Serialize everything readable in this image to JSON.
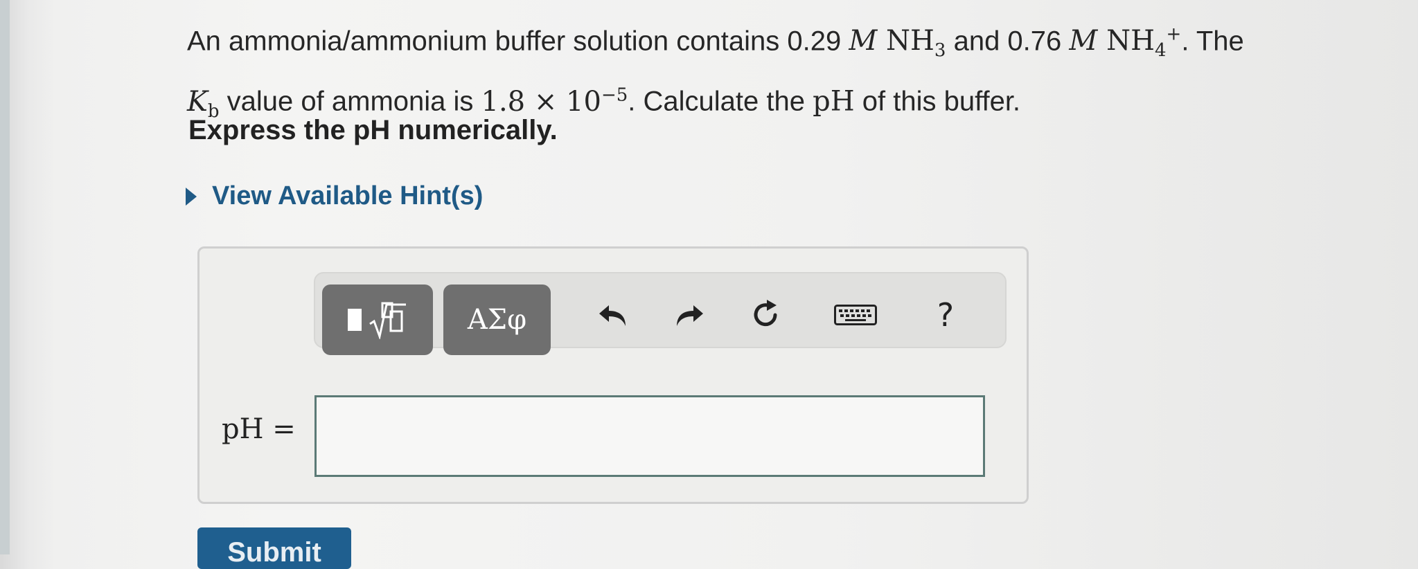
{
  "question": {
    "line1_text_a": "An ammonia/ammonium buffer solution contains 0.29 ",
    "line1_unit_a": "M",
    "line1_species_a": "NH",
    "line1_species_a_sub": "3",
    "line1_text_b": " and 0.76 ",
    "line1_unit_b": "M",
    "line1_species_b": "NH",
    "line1_species_b_sub": "4",
    "line1_species_b_sup": "+",
    "line1_text_c": ". The",
    "kb_symbol": "K",
    "kb_sub": "b",
    "line2_text_a": " value of ammonia is ",
    "kb_value_mantissa": "1.8 × 10",
    "kb_value_exponent": "−5",
    "line2_text_b": ". Calculate the ",
    "ph_symbol": "pH",
    "line2_text_c": " of this buffer."
  },
  "instruction": "Express the pH numerically.",
  "hint": {
    "label": "View Available Hint(s)"
  },
  "toolbar": {
    "greek_label": "ΑΣφ",
    "help_label": "?"
  },
  "answer": {
    "label": "pH =",
    "value": ""
  },
  "submit": {
    "label": "Submit"
  },
  "colors": {
    "link": "#1f5a86",
    "toolbar_button": "#6f6f6f",
    "submit": "#1f5f8f",
    "input_border": "#5b7a76"
  }
}
